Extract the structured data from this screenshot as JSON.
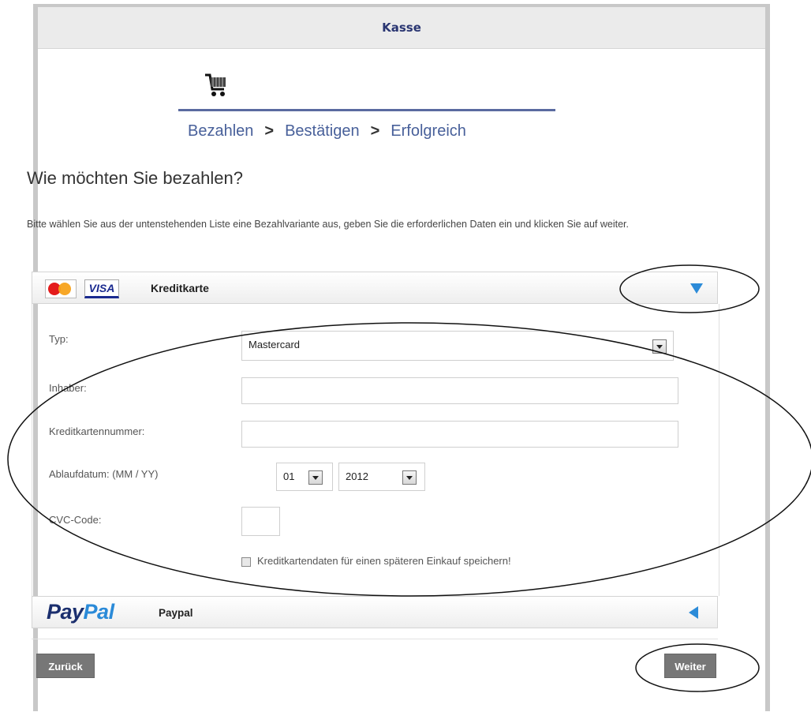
{
  "header": {
    "title": "Kasse"
  },
  "progress": {
    "steps": [
      "Bezahlen",
      "Bestätigen",
      "Erfolgreich"
    ],
    "separator": ">"
  },
  "question": "Wie möchten Sie bezahlen?",
  "instructions": "Bitte wählen Sie aus der untenstehenden Liste eine Bezahlvariante aus, geben Sie die erforderlichen Daten ein und klicken Sie auf weiter.",
  "methods": [
    {
      "label": "Kreditkarte",
      "logos": [
        "mastercard-logo",
        "visa-logo"
      ],
      "logo_text": [
        "VISA"
      ],
      "expanded": true
    },
    {
      "label": "Paypal",
      "logos": [
        "paypal-logo"
      ],
      "logo_text": [
        "Pay",
        "Pal"
      ],
      "expanded": false
    }
  ],
  "form": {
    "type_label": "Typ:",
    "type_value": "Mastercard",
    "holder_label": "Inhaber:",
    "holder_value": "",
    "cardnumber_label": "Kreditkartennummer:",
    "cardnumber_value": "",
    "expiry_label": "Ablaufdatum: (MM / YY)",
    "expiry_month": "01",
    "expiry_year": "2012",
    "cvc_label": "CVC-Code:",
    "cvc_value": "",
    "save_label": "Kreditkartendaten für einen späteren Einkauf speichern!",
    "save_checked": false
  },
  "buttons": {
    "back": "Zurück",
    "next": "Weiter"
  },
  "colors": {
    "accent": "#2c8bd8",
    "header_text": "#2a3672",
    "button": "#777777"
  }
}
